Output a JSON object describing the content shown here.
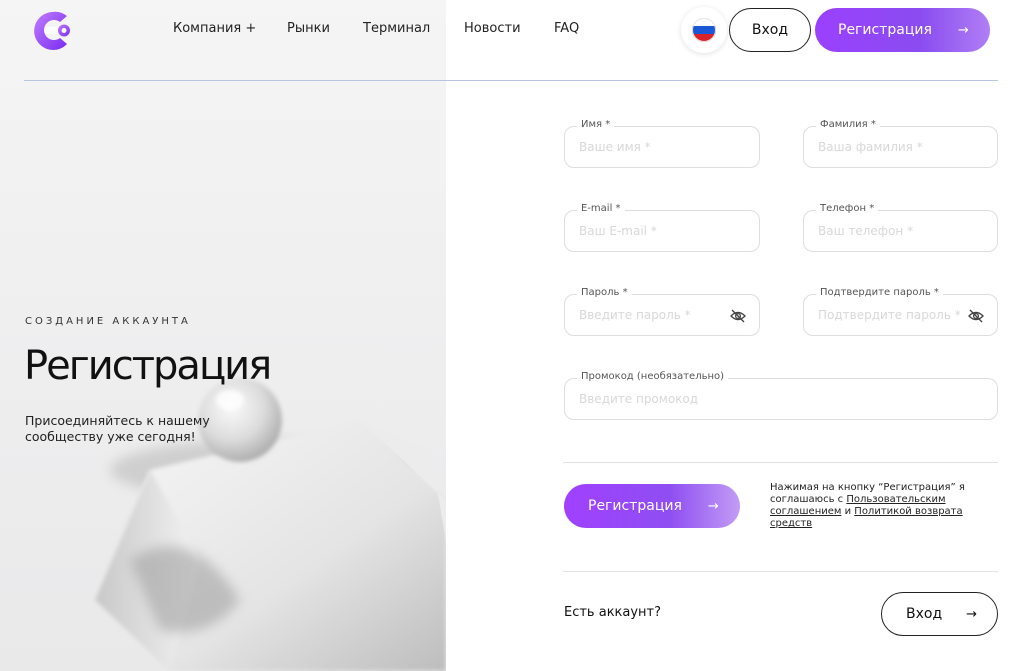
{
  "header": {
    "nav": [
      {
        "label": "Компания +"
      },
      {
        "label": "Рынки"
      },
      {
        "label": "Терминал"
      },
      {
        "label": "Новости"
      },
      {
        "label": "FAQ"
      }
    ],
    "login_label": "Вход",
    "register_label": "Регистрация",
    "arrow": "→"
  },
  "hero": {
    "eyebrow": "СОЗДАНИЕ АККАУНТА",
    "title": "Регистрация",
    "subtitle": "Присоединяйтесь к нашему сообществу уже сегодня!"
  },
  "form": {
    "first_name": {
      "label": "Имя *",
      "placeholder": "Ваше имя *",
      "value": ""
    },
    "last_name": {
      "label": "Фамилия *",
      "placeholder": "Ваша фамилия *",
      "value": ""
    },
    "email": {
      "label": "E-mail *",
      "placeholder": "Ваш E-mail *",
      "value": ""
    },
    "phone": {
      "label": "Телефон *",
      "placeholder": "Ваш телефон *",
      "value": ""
    },
    "password": {
      "label": "Пароль *",
      "placeholder": "Введите пароль *",
      "value": ""
    },
    "password_confirm": {
      "label": "Подтвердите пароль *",
      "placeholder": "Подтвердите пароль *",
      "value": ""
    },
    "promo": {
      "label": "Промокод (необязательно)",
      "placeholder": "Введите промокод",
      "value": ""
    },
    "submit_label": "Регистрация",
    "consent_prefix": "Нажимая на кнопку “Регистрация” я соглашаюсь с ",
    "consent_link_terms": "Пользовательским соглашением",
    "consent_and": " и ",
    "consent_link_refund": "Политикой возврата средств",
    "have_account": "Есть аккаунт?",
    "login_label": "Вход"
  },
  "colors": {
    "accent": "#9b40ff",
    "accent_light": "#c29cf5"
  }
}
